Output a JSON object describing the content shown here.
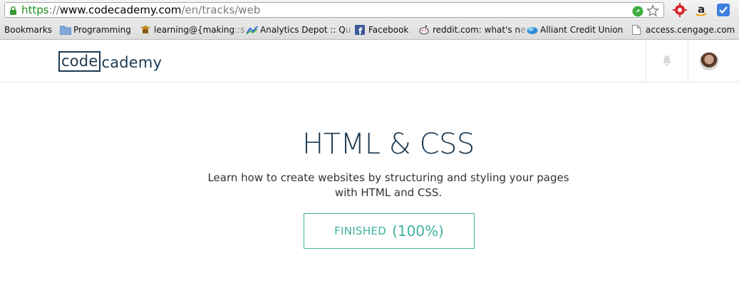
{
  "browser": {
    "url_scheme": "https",
    "url_sep": "://",
    "url_host": "www.codecademy.com",
    "url_path": "/en/tracks/web"
  },
  "bookmarks": {
    "label": "Bookmarks",
    "items": [
      {
        "label": "Programming"
      },
      {
        "label": "learning@{making",
        "fade": "::s"
      },
      {
        "label": "Analytics Depot :: Q",
        "fade": "u"
      },
      {
        "label": "Facebook"
      },
      {
        "label": "reddit.com: what's n",
        "fade": "e"
      },
      {
        "label": "Alliant Credit Union"
      },
      {
        "label": "access.cengage.com"
      }
    ]
  },
  "site": {
    "logo_box": "code",
    "logo_rest": "cademy"
  },
  "main": {
    "title": "HTML & CSS",
    "description": "Learn how to create websites by structuring and styling your pages with HTML and CSS.",
    "status_label": "FINISHED",
    "status_percent": "(100%)"
  },
  "colors": {
    "brand": "#1c3a52",
    "accent": "#3fb29e"
  }
}
